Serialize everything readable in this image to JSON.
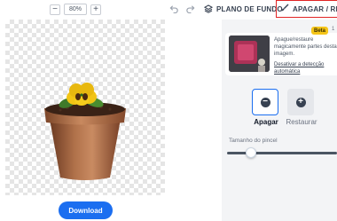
{
  "zoom": {
    "minus": "−",
    "value": "80%",
    "plus": "+"
  },
  "download": {
    "label": "Download"
  },
  "toolbar": {
    "background_tab": "PLANO DE FUNDO",
    "erase_restore_tab": "APAGAR / RESTAURAR"
  },
  "feature": {
    "badge": "Beta",
    "badge_count": "1",
    "description": "Apague/restaure magicamente partes desta imagem.",
    "link": "Desativar a detecção automática"
  },
  "tools": {
    "erase_label": "Apagar",
    "restore_label": "Restaurar"
  },
  "brush": {
    "label": "Tamanho do pincel",
    "level": 0.22
  },
  "colors": {
    "accent": "#1b6ef0",
    "highlight": "#e02424",
    "beta": "#f5c518"
  },
  "icons": [
    "undo-icon",
    "redo-icon",
    "layers-icon",
    "brush-icon",
    "minus-circle-icon",
    "plus-circle-icon"
  ]
}
